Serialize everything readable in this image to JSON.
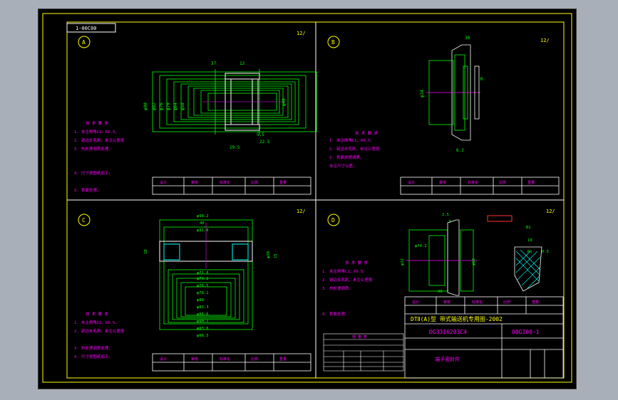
{
  "drawing_code": "1-00C00",
  "roughness": "12/",
  "colors": {
    "frame": "#ffff00",
    "geometry": "#00ff00",
    "dim": "#00ff00",
    "notes": "#ff00ff",
    "white": "#ffffff",
    "cyan": "#00ffff",
    "red": "#ff3333",
    "hatch": "#00ffff"
  },
  "views": {
    "a": {
      "letter": "A"
    },
    "b": {
      "letter": "B"
    },
    "c": {
      "letter": "C"
    },
    "d": {
      "letter": "D"
    }
  },
  "tech_notes_title": "技 术 要 求",
  "notes_a": [
    "1. 未注倒角C1，R0.5。",
    "2. 锐边去毛刺，未注公差按",
    "3. 热处理调质处理。",
    "4. 尺寸按图纸加工，",
    "5. 表面处理。"
  ],
  "notes_b": [
    "1. 未注倒角C1，R0.5。",
    "2. 锐边去毛刺，未注公差按",
    "3. 表面处理调质。",
    "   未注尺寸公差。"
  ],
  "notes_c": [
    "1. 未注倒角C1，R0.5。",
    "2. 锐边去毛刺，未注公差按",
    "3. 热处理调质处理，",
    "4. 尺寸按图纸加工。"
  ],
  "notes_d": [
    "1. 未注倒角C1，R0.5。",
    "2. 锐边去毛刺，未注公差按",
    "3. 热处理调质，",
    "4. 表面处理。"
  ],
  "title_block": {
    "project": "DTⅡ(A)型 带式输送机专用图-2002",
    "model": "DG3316203C4",
    "drawing_no": "00G100-1",
    "part_name": "端子密封件"
  },
  "small_table_labels": [
    "设计",
    "审核",
    "标准化",
    "比例",
    "重量"
  ],
  "dims_a": [
    "φ90",
    "φ82",
    "φ76",
    "φ70",
    "φ64",
    "φ58",
    "37",
    "12",
    "5.5",
    "22.5",
    "29.5",
    "φ40"
  ],
  "dims_b": [
    "30",
    "φ34",
    "R",
    "6.2"
  ],
  "dims_c": [
    "φ90.2",
    "40",
    "φ31.8",
    "10",
    "φ20",
    "15",
    "φ71.8",
    "φ73.2",
    "φ76.5",
    "φ78.1",
    "φ80",
    "φ83.3",
    "φ86.6",
    "φ90.1",
    "φ93.6",
    "φ98.5"
  ],
  "dims_d": [
    "φ32",
    "φ62",
    "φ74.2",
    "2.5",
    "5",
    "20",
    "19",
    "0.5",
    "B1",
    "R1"
  ],
  "spec_table_title": "规 格 表"
}
